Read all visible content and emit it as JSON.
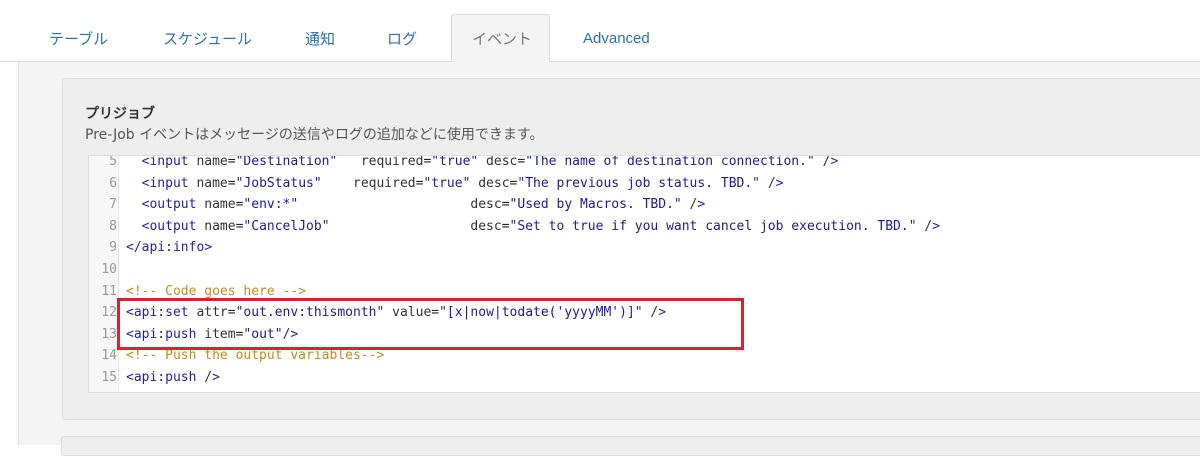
{
  "tabs": [
    {
      "label": "テーブル",
      "active": false
    },
    {
      "label": "スケジュール",
      "active": false
    },
    {
      "label": "通知",
      "active": false
    },
    {
      "label": "ログ",
      "active": false
    },
    {
      "label": "イベント",
      "active": true
    },
    {
      "label": "Advanced",
      "active": false
    }
  ],
  "section": {
    "title": "プリジョブ",
    "description": "Pre-Job イベントはメッセージの送信やログの追加などに使用できます。"
  },
  "editor": {
    "lines": [
      {
        "n": "5",
        "text": "  <input name=\"Destination\"   required=\"true\" desc=\"The name of destination connection.\" />"
      },
      {
        "n": "6",
        "text": "  <input name=\"JobStatus\"    required=\"true\" desc=\"The previous job status. TBD.\" />"
      },
      {
        "n": "7",
        "text": "  <output name=\"env:*\"                      desc=\"Used by Macros. TBD.\" />"
      },
      {
        "n": "8",
        "text": "  <output name=\"CancelJob\"                  desc=\"Set to true if you want cancel job execution. TBD.\" />"
      },
      {
        "n": "9",
        "text": "</api:info>"
      },
      {
        "n": "10",
        "text": ""
      },
      {
        "n": "11",
        "text": "<!-- Code goes here -->"
      },
      {
        "n": "12",
        "text": "<api:set attr=\"out.env:thismonth\" value=\"[x|now|todate('yyyyMM')]\" />"
      },
      {
        "n": "13",
        "text": "<api:push item=\"out\"/>"
      },
      {
        "n": "14",
        "text": "<!-- Push the output variables-->"
      },
      {
        "n": "15",
        "text": "<api:push />"
      }
    ]
  },
  "colors": {
    "tab_link": "#2a6fbe",
    "highlight": "#e01e2e",
    "comment": "#c98a1a",
    "tag": "#1f1fb8"
  }
}
